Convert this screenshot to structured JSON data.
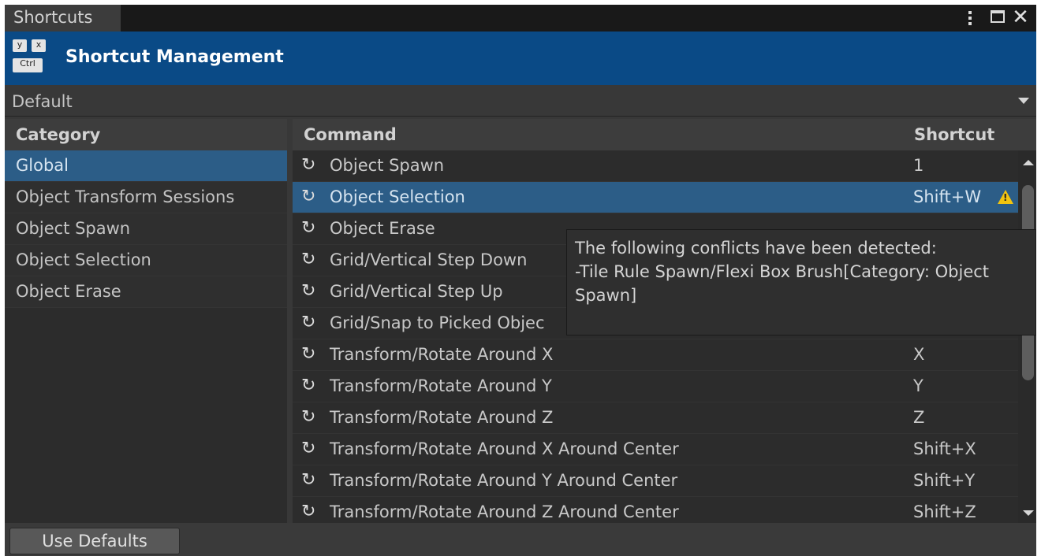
{
  "window": {
    "tab_title": "Shortcuts",
    "header_title": "Shortcut Management",
    "key_icon": {
      "keys": [
        "y",
        "x",
        "Ctrl"
      ]
    }
  },
  "profile": {
    "selected": "Default"
  },
  "categories": {
    "header": "Category",
    "items": [
      "Global",
      "Object Transform Sessions",
      "Object Spawn",
      "Object Selection",
      "Object Erase"
    ],
    "selected_index": 0
  },
  "commands": {
    "header_command": "Command",
    "header_shortcut": "Shortcut",
    "rows": [
      {
        "command": "Object Spawn",
        "shortcut": "1"
      },
      {
        "command": "Object Selection",
        "shortcut": "Shift+W",
        "warning": true,
        "selected": true
      },
      {
        "command": "Object Erase",
        "shortcut": ""
      },
      {
        "command": "Grid/Vertical Step Down",
        "shortcut": ""
      },
      {
        "command": "Grid/Vertical Step Up",
        "shortcut": ""
      },
      {
        "command": "Grid/Snap to Picked Objec",
        "shortcut": ""
      },
      {
        "command": "Transform/Rotate Around X",
        "shortcut": "X"
      },
      {
        "command": "Transform/Rotate Around Y",
        "shortcut": "Y"
      },
      {
        "command": "Transform/Rotate Around Z",
        "shortcut": "Z"
      },
      {
        "command": "Transform/Rotate Around X Around Center",
        "shortcut": "Shift+X"
      },
      {
        "command": "Transform/Rotate Around Y Around Center",
        "shortcut": "Shift+Y"
      },
      {
        "command": "Transform/Rotate Around Z Around Center",
        "shortcut": "Shift+Z"
      }
    ]
  },
  "tooltip": {
    "lines": [
      "The following conflicts have been detected:",
      "-Tile Rule Spawn/Flexi Box Brush[Category: Object",
      "Spawn]"
    ]
  },
  "footer": {
    "use_defaults_label": "Use Defaults"
  },
  "icons": {
    "reset": "reset-icon",
    "warning": "warning-icon",
    "menu": "kebab-menu-icon",
    "maximize": "maximize-icon",
    "close": "close-icon"
  },
  "colors": {
    "header_blue": "#0a4a86",
    "selection_blue": "#2c5d87",
    "warning_yellow": "#f2c40f"
  }
}
